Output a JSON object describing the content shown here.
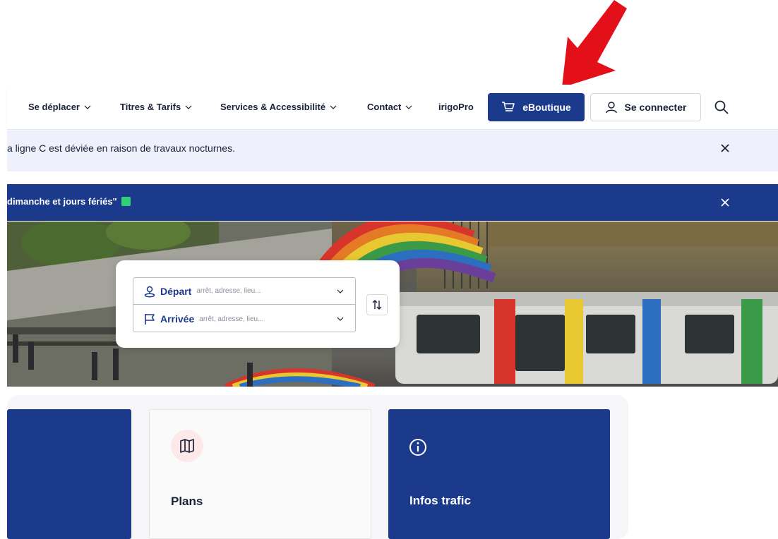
{
  "nav": {
    "items": [
      {
        "label": "Se déplacer",
        "dropdown": true
      },
      {
        "label": "Titres & Tarifs",
        "dropdown": true
      },
      {
        "label": "Services & Accessibilité",
        "dropdown": true
      },
      {
        "label": "Contact",
        "dropdown": true
      },
      {
        "label": "irigoPro",
        "dropdown": false
      }
    ],
    "eboutique_label": "eBoutique",
    "login_label": "Se connecter"
  },
  "alerts": {
    "info_text": "a ligne C est déviée en raison de travaux nocturnes.",
    "banner_text": "dimanche et jours fériés\""
  },
  "route": {
    "departure_label": "Départ",
    "departure_placeholder": "arrêt, adresse, lieu...",
    "arrival_label": "Arrivée",
    "arrival_placeholder": "arrêt, adresse, lieu..."
  },
  "cards": {
    "plans_title": "Plans",
    "traffic_title": "Infos trafic"
  },
  "colors": {
    "brand_blue": "#1c3a8c",
    "alert_light_bg": "#eef0fb",
    "annotation_red": "#e3101a",
    "status_green": "#2fcf76"
  }
}
